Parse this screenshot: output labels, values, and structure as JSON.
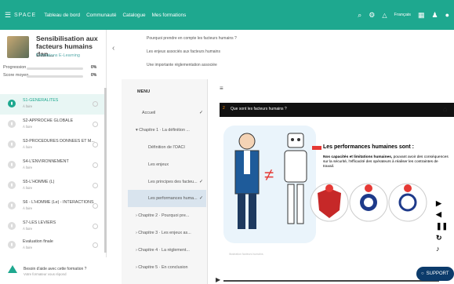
{
  "topbar": {
    "logo": "SPACE",
    "nav": [
      "Tableau de bord",
      "Communauté",
      "Catalogue",
      "Mes formations"
    ],
    "lang": "Français",
    "colors": {
      "bg": "#1ea88f"
    }
  },
  "course": {
    "title": "Sensibilisation aux facteurs humains dan...",
    "subtitle": "Formations E-Learning",
    "progress_label": "Progression",
    "progress_value": "0%",
    "score_label": "Score moyen",
    "score_value": "0%"
  },
  "modules": [
    {
      "title": "S1-GENERALITES",
      "sub": "À faire",
      "active": true
    },
    {
      "title": "S2-APPROCHE GLOBALE",
      "sub": "À faire"
    },
    {
      "title": "S3-PROCEDURES DONNEES ET M...",
      "sub": "À faire"
    },
    {
      "title": "S4-L'ENVIRONNEMENT",
      "sub": "À faire"
    },
    {
      "title": "S5-L'HOMME (L)",
      "sub": "À faire"
    },
    {
      "title": "S6 - L'HOMME (Le) - INTERACTIONS",
      "sub": "À faire"
    },
    {
      "title": "S7-LES LEVIERS",
      "sub": "À faire"
    },
    {
      "title": "Evaluation finale",
      "sub": "À faire"
    }
  ],
  "help": {
    "line1": "Besoin d'aide avec cette formation ?",
    "line2": "Votre formateur vous répond"
  },
  "topics": [
    "Pourquoi prendre en compte les facteurs humains ?",
    "Les enjeux associés aux facteurs humains",
    "Une importante réglementation associée"
  ],
  "menu": {
    "header": "MENU",
    "items": [
      {
        "label": "Accueil",
        "check": "✓"
      },
      {
        "label": "▾  Chapitre 1 · La définition ...",
        "check": ""
      },
      {
        "label": "Définition de l'OACI",
        "check": ""
      },
      {
        "label": "Les enjeux",
        "check": ""
      },
      {
        "label": "Les principes des facteu...",
        "check": "✓"
      },
      {
        "label": "Les performances huma...",
        "check": "✓"
      },
      {
        "label": "›  Chapitre 2 · Pourquoi pre...",
        "check": ""
      },
      {
        "label": "›  Chapitre 3 · Les enjeux as...",
        "check": ""
      },
      {
        "label": "›  Chapitre 4 · La réglement...",
        "check": ""
      },
      {
        "label": "›  Chapitre 5 · En conclusion",
        "check": ""
      }
    ]
  },
  "slide": {
    "number": "2",
    "title": "Que sont les facteurs humains ?",
    "perf_title": "Les performances humaines sont :",
    "perf_bold": "Nos capacités et limitations humaines,",
    "perf_rest": " pouvant avoir des conséquences sur la sécurité, l'efficacité des opérateurs à réaliser les contraintes de travail.",
    "caption": "Illustration facteurs humains"
  },
  "support": "SUPPORT"
}
